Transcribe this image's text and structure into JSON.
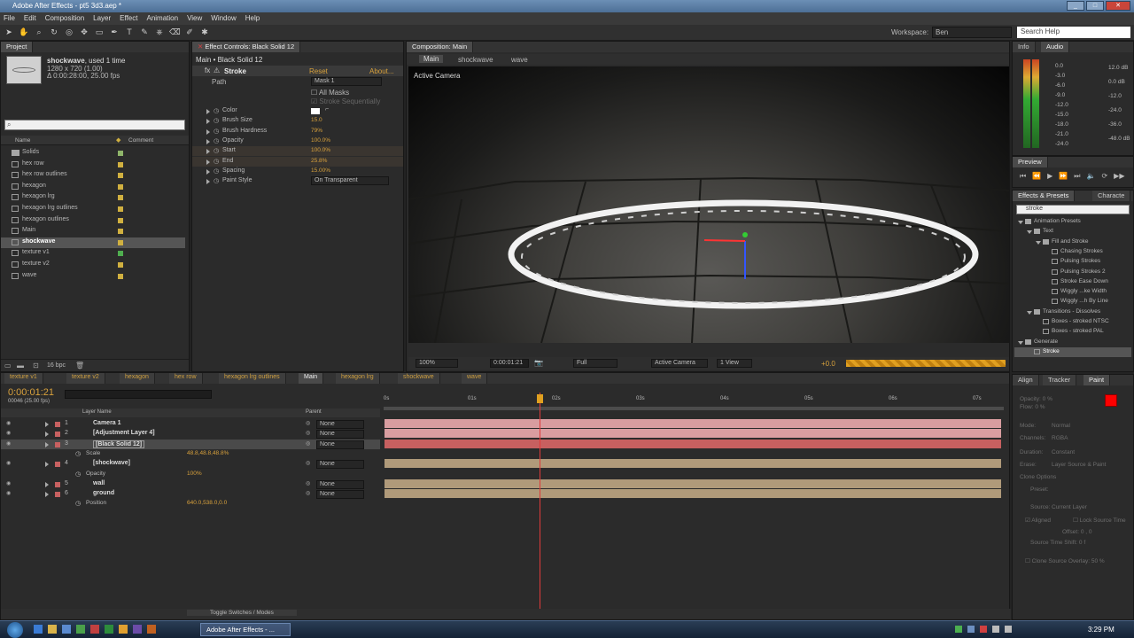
{
  "window": {
    "title": "Adobe After Effects - pt5 3d3.aep *"
  },
  "menu": [
    "File",
    "Edit",
    "Composition",
    "Layer",
    "Effect",
    "Animation",
    "View",
    "Window",
    "Help"
  ],
  "toolbar": {
    "workspace_label": "Workspace:",
    "workspace_value": "Ben",
    "search_placeholder": "Search Help"
  },
  "project": {
    "tab": "Project",
    "selected_name": "shockwave",
    "selected_used": ", used 1 time",
    "selected_size": "1280 x 720 (1.00)",
    "selected_duration": "Δ 0:00:28:00, 25.00 fps",
    "col_name": "Name",
    "col_comment": "Comment",
    "items": [
      {
        "name": "Solids",
        "type": "folder",
        "color": "#8fb56a"
      },
      {
        "name": "hex row",
        "type": "comp",
        "color": "#d0b040"
      },
      {
        "name": "hex row outlines",
        "type": "comp",
        "color": "#d0b040"
      },
      {
        "name": "hexagon",
        "type": "comp",
        "color": "#d0b040"
      },
      {
        "name": "hexagon lrg",
        "type": "comp",
        "color": "#d0b040"
      },
      {
        "name": "hexagon lrg outlines",
        "type": "comp",
        "color": "#d0b040"
      },
      {
        "name": "hexagon outlines",
        "type": "comp",
        "color": "#d0b040"
      },
      {
        "name": "Main",
        "type": "comp",
        "color": "#d0b040"
      },
      {
        "name": "shockwave",
        "type": "comp",
        "color": "#d0b040",
        "selected": true
      },
      {
        "name": "texture v1",
        "type": "comp",
        "color": "#4fae4f"
      },
      {
        "name": "texture v2",
        "type": "comp",
        "color": "#d0b040"
      },
      {
        "name": "wave",
        "type": "comp",
        "color": "#d0b040"
      }
    ],
    "bpc": "16 bpc"
  },
  "effect_controls": {
    "tab": "Effect Controls: Black Solid 12",
    "breadcrumb": "Main • Black Solid 12",
    "effect": "Stroke",
    "reset": "Reset",
    "about": "About...",
    "path_label": "Path",
    "path_value": "Mask 1",
    "all_masks": "All Masks",
    "stroke_seq": "Stroke Sequentially",
    "props": [
      {
        "name": "Color",
        "value": ""
      },
      {
        "name": "Brush Size",
        "value": "15.0"
      },
      {
        "name": "Brush Hardness",
        "value": "79%"
      },
      {
        "name": "Opacity",
        "value": "100.0%"
      },
      {
        "name": "Start",
        "value": "100.0%"
      },
      {
        "name": "End",
        "value": "25.8%"
      },
      {
        "name": "Spacing",
        "value": "15.00%"
      },
      {
        "name": "Paint Style",
        "value": "On Transparent"
      }
    ]
  },
  "composition": {
    "tab": "Composition: Main",
    "crumbs": [
      "Main",
      "shockwave",
      "wave"
    ],
    "camera_label": "Active Camera",
    "zoom": "100%",
    "time": "0:00:01:21",
    "quality": "Full",
    "view": "Active Camera",
    "views": "1 View",
    "exposure": "+0.0"
  },
  "info": {
    "tabs": [
      "Info",
      "Audio"
    ],
    "levels_left": [
      "0.0",
      "-3.0",
      "-6.0",
      "-9.0",
      "-12.0",
      "-15.0",
      "-18.0",
      "-21.0",
      "-24.0"
    ],
    "levels_right": [
      "12.0 dB",
      "0.0 dB",
      "-12.0",
      "-24.0",
      "-36.0",
      "-48.0 dB"
    ]
  },
  "preview": {
    "tab": "Preview"
  },
  "effects_presets": {
    "tabs": [
      "Effects & Presets",
      "Characte"
    ],
    "search": "stroke",
    "tree": [
      {
        "label": "Animation Presets",
        "level": 0,
        "type": "folder"
      },
      {
        "label": "Text",
        "level": 1,
        "type": "folder"
      },
      {
        "label": "Fill and Stroke",
        "level": 2,
        "type": "folder"
      },
      {
        "label": "Chasing Strokes",
        "level": 3,
        "type": "preset"
      },
      {
        "label": "Pulsing Strokes",
        "level": 3,
        "type": "preset"
      },
      {
        "label": "Pulsing Strokes 2",
        "level": 3,
        "type": "preset"
      },
      {
        "label": "Stroke Ease Down",
        "level": 3,
        "type": "preset"
      },
      {
        "label": "Wiggly ...ke Width",
        "level": 3,
        "type": "preset"
      },
      {
        "label": "Wiggly ...h By Line",
        "level": 3,
        "type": "preset"
      },
      {
        "label": "Transitions - Dissolves",
        "level": 1,
        "type": "folder"
      },
      {
        "label": "Boxes - stroked NTSC",
        "level": 2,
        "type": "preset"
      },
      {
        "label": "Boxes - stroked PAL",
        "level": 2,
        "type": "preset"
      },
      {
        "label": "Generate",
        "level": 0,
        "type": "folder"
      },
      {
        "label": "Stroke",
        "level": 1,
        "type": "effect",
        "selected": true
      }
    ]
  },
  "paint": {
    "tabs": [
      "Align",
      "Tracker",
      "Paint"
    ],
    "opacity": "Opacity: 0 %",
    "flow": "Flow: 0 %",
    "mode": "Mode:",
    "mode_val": "Normal",
    "channels": "Channels:",
    "channels_val": "RGBA",
    "duration": "Duration:",
    "duration_val": "Constant",
    "erase": "Erase:",
    "erase_val": "Layer Source & Paint",
    "clone": "Clone Options",
    "preset": "Preset:",
    "source": "Source:",
    "source_val": "Current Layer",
    "aligned": "Aligned",
    "lock": "Lock Source Time",
    "offset": "Offset: 0 , 0",
    "shift": "Source Time Shift: 0 f",
    "overlay": "Clone Source Overlay: 50 %"
  },
  "timeline": {
    "tabs": [
      "texture v1",
      "texture v2",
      "hexagon",
      "hex row",
      "hexagon lrg outlines",
      "Main",
      "hexagon lrg",
      "shockwave",
      "wave"
    ],
    "active_tab": "Main",
    "time": "0:00:01:21",
    "fps": "00046 (25.00 fps)",
    "col_layer": "Layer Name",
    "col_parent": "Parent",
    "ruler": [
      "0s",
      "01s",
      "02s",
      "03s",
      "04s",
      "05s",
      "06s",
      "07s"
    ],
    "layers": [
      {
        "num": "1",
        "name": "Camera 1",
        "parent": "None",
        "bar": "#d99da0"
      },
      {
        "num": "2",
        "name": "[Adjustment Layer 4]",
        "parent": "None",
        "bar": "#d99da0"
      },
      {
        "num": "3",
        "name": "[Black Solid 12]",
        "parent": "None",
        "bar": "#c76060",
        "selected": true
      },
      {
        "num": "",
        "name": "Scale",
        "value": "48.8,48.8,48.8%",
        "prop": true
      },
      {
        "num": "4",
        "name": "[shockwave]",
        "parent": "None",
        "bar": "#b09a7a"
      },
      {
        "num": "",
        "name": "Opacity",
        "value": "100%",
        "prop": true
      },
      {
        "num": "5",
        "name": "wall",
        "parent": "None",
        "bar": "#b09a7a"
      },
      {
        "num": "6",
        "name": "ground",
        "parent": "None",
        "bar": "#b09a7a"
      },
      {
        "num": "",
        "name": "Position",
        "value": "640.0,538.0,0.0",
        "prop": true
      }
    ],
    "toggle": "Toggle Switches / Modes"
  },
  "taskbar": {
    "app": "Adobe After Effects - ...",
    "time": "3:29 PM"
  }
}
